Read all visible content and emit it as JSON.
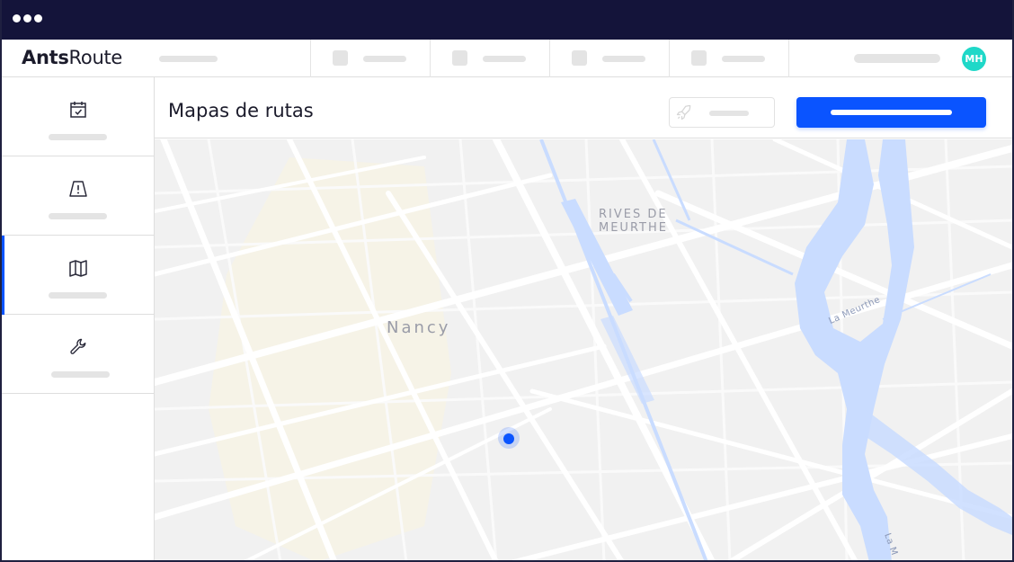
{
  "app": {
    "logo_bold": "Ants",
    "logo_regular": "Route",
    "user_initials": "MH",
    "accent_color": "#0a54ff",
    "avatar_color": "#1fd8c8",
    "titlebar_color": "#14143a"
  },
  "sidebar": {
    "items": [
      {
        "icon": "calendar-check-icon",
        "active": false
      },
      {
        "icon": "road-warning-icon",
        "active": false
      },
      {
        "icon": "map-icon",
        "active": true
      },
      {
        "icon": "wrench-icon",
        "active": false
      }
    ]
  },
  "header": {
    "title": "Mapas de rutas",
    "secondary_button_icon": "rocket-icon"
  },
  "map": {
    "labels": {
      "city": "Nancy",
      "district_line1": "RIVES DE",
      "district_line2": "MEURTHE",
      "river": "La Meurthe",
      "river_lower": "La M"
    }
  }
}
